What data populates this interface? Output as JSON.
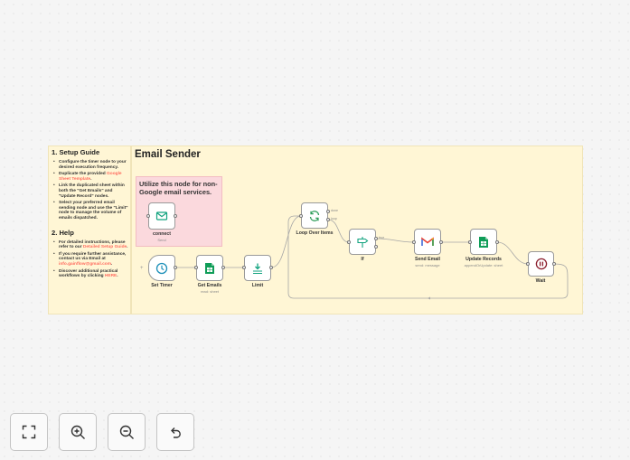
{
  "setup_guide": {
    "title": "1. Setup Guide",
    "items": [
      [
        "Configure the timer node to your desired execution frequency."
      ],
      [
        "Duplicate the provided ",
        "Google Sheet Template",
        "."
      ],
      [
        "Link the duplicated sheet within both the \"Get Emails\" and \"Update Record\" nodes."
      ],
      [
        "Select your preferred email sending node and use the \"Limit\" node to manage the volume of emails dispatched."
      ]
    ]
  },
  "help": {
    "title": "2. Help",
    "items": [
      [
        "For detailed instructions, please refer to our ",
        "Detailed Setup Guide",
        "."
      ],
      [
        "If you require further assistance, contact us via Email at ",
        "info.gainflow@gmail.com",
        "."
      ],
      [
        "Discover additional practical workflows by clicking ",
        "HERE",
        "."
      ]
    ]
  },
  "main_note": {
    "title": "Email Sender"
  },
  "pink_note": {
    "text": "Utilize this node for non-Google email services."
  },
  "nodes": {
    "connect": {
      "label": "connect",
      "sub": "Send"
    },
    "set_timer": {
      "label": "Set Timer"
    },
    "get_emails": {
      "label": "Get Emails",
      "sub": "read: sheet"
    },
    "limit": {
      "label": "Limit"
    },
    "loop": {
      "label": "Loop Over Items",
      "port_done": "done",
      "port_loop": "loop"
    },
    "if": {
      "label": "If",
      "port_true": "true"
    },
    "send_email": {
      "label": "Send Email",
      "sub": "send: message"
    },
    "update_records": {
      "label": "Update Records",
      "sub": "appendOrUpdate: sheet"
    },
    "wait": {
      "label": "Wait"
    }
  },
  "colors": {
    "link": "#ff6b5e",
    "sticky_yellow": "#fff6d5",
    "sticky_pink": "#fbd9dd",
    "sheets_green": "#0f9d58",
    "timer_teal": "#1b8fb8",
    "loop_green": "#2e9e59",
    "wait_maroon": "#8a1c2b"
  },
  "controls": [
    {
      "name": "zoom-to-fit-button",
      "icon": "fit-view-icon"
    },
    {
      "name": "zoom-in-button",
      "icon": "zoom-in-icon"
    },
    {
      "name": "zoom-out-button",
      "icon": "zoom-out-icon"
    },
    {
      "name": "reset-zoom-button",
      "icon": "undo-icon"
    }
  ]
}
